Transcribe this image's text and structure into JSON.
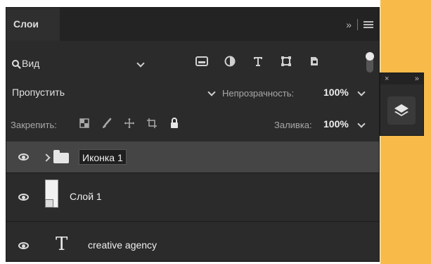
{
  "panel": {
    "tab_label": "Слои",
    "collapse_label": "»"
  },
  "filter_bar": {
    "search_value": "Вид",
    "filter_icons": [
      "image-filter-icon",
      "adjustment-filter-icon",
      "type-filter-icon",
      "shape-filter-icon",
      "smart-object-filter-icon"
    ]
  },
  "blend_bar": {
    "blend_mode": "Пропустить",
    "opacity_label": "Непрозрачность:",
    "opacity_value": "100%"
  },
  "lock_bar": {
    "lock_label": "Закрепить:",
    "lock_icons": [
      "lock-transparent-pixels-icon",
      "lock-image-pixels-icon",
      "lock-position-icon",
      "lock-artboard-icon",
      "lock-all-icon"
    ],
    "fill_label": "Заливка:",
    "fill_value": "100%"
  },
  "layers": [
    {
      "name": "Иконка 1",
      "kind": "group",
      "visible": true,
      "selected": true
    },
    {
      "name": "Слой 1",
      "kind": "smart-object",
      "visible": true,
      "selected": false
    },
    {
      "name": "creative agency",
      "kind": "text",
      "visible": true,
      "selected": false
    }
  ],
  "dock": {
    "close_label": "×",
    "expand_label": "»"
  },
  "colors": {
    "panel_bg": "#2b2b2b",
    "accent_bg": "#f8bb4a",
    "selected_row": "#454545"
  }
}
